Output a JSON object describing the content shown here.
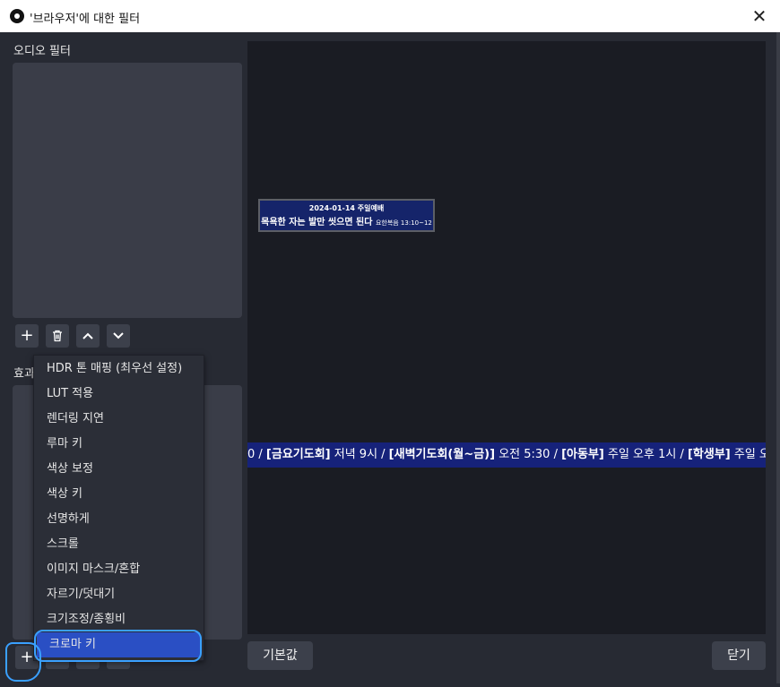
{
  "window": {
    "title": "'브라우저'에 대한 필터",
    "close_glyph": "✕"
  },
  "audio_filters": {
    "label": "오디오 필터"
  },
  "effect_filters": {
    "label": "효과 필터"
  },
  "toolbar": {
    "add_glyph": "+",
    "up_glyph": "∧",
    "down_glyph": "∨"
  },
  "context_menu": {
    "items": [
      "HDR 톤 매핑 (최우선 설정)",
      "LUT 적용",
      "렌더링 지연",
      "루마 키",
      "색상 보정",
      "색상 키",
      "선명하게",
      "스크롤",
      "이미지 마스크/혼합",
      "자르기/덧대기",
      "크기조정/종횡비",
      "크로마 키"
    ],
    "selected": "크로마 키"
  },
  "preview": {
    "card_date": "2024-01-14 주일예배",
    "card_title": "목욕한 자는 발만 씻으면 된다",
    "card_ref": "요한복음 13:10~12",
    "ticker": {
      "t1": "0 / ",
      "b1": "[금요기도회]",
      "t2": " 저녁 9시 / ",
      "b2": "[새벽기도회(월~금)]",
      "t3": " 오전 5:30 / ",
      "b3": "[아동부]",
      "t4": " 주일 오후 1시 / ",
      "b4": "[학생부]",
      "t5": " 주일 오후"
    }
  },
  "buttons": {
    "defaults": "기본값",
    "close": "닫기"
  },
  "colors": {
    "accent": "#2a4fc4",
    "ticker_bg": "#16227a",
    "annotation": "#3aa0ff"
  }
}
